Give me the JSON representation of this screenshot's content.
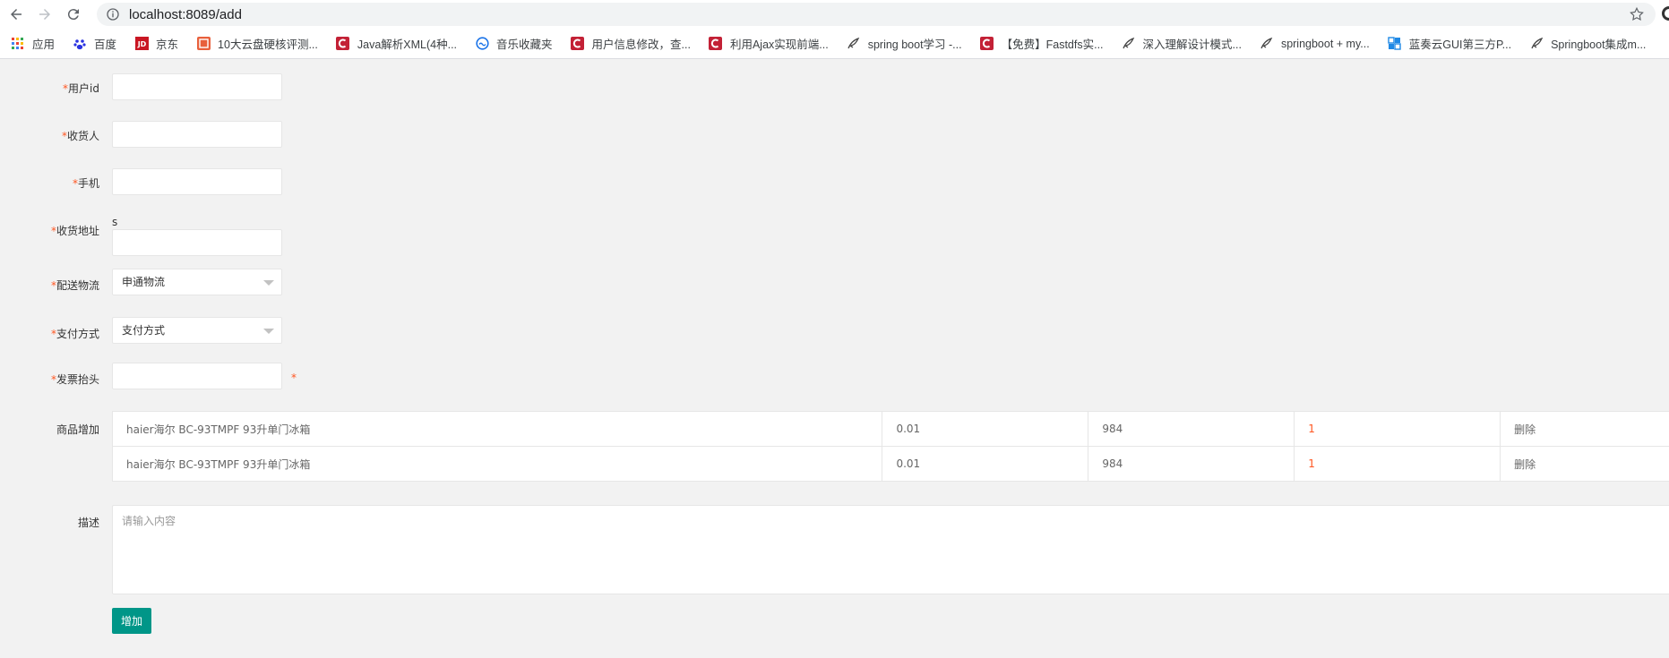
{
  "browser": {
    "url": "localhost:8089/add",
    "bookmarks": [
      {
        "label": "应用",
        "icon": "apps-grid-icon"
      },
      {
        "label": "百度",
        "icon": "baidu-paw-icon"
      },
      {
        "label": "京东",
        "icon": "jd-logo-icon"
      },
      {
        "label": "10大云盘硬核评测...",
        "icon": "jian-logo-icon"
      },
      {
        "label": "Java解析XML(4种...",
        "icon": "csdn-c-icon"
      },
      {
        "label": "音乐收藏夹",
        "icon": "music-circle-icon"
      },
      {
        "label": "用户信息修改，查...",
        "icon": "csdn-c-icon"
      },
      {
        "label": "利用Ajax实现前端...",
        "icon": "csdn-c-icon"
      },
      {
        "label": "spring boot学习 -...",
        "icon": "feather-icon"
      },
      {
        "label": "【免费】Fastdfs实...",
        "icon": "csdn-c-icon"
      },
      {
        "label": "深入理解设计模式...",
        "icon": "feather-icon"
      },
      {
        "label": "springboot + my...",
        "icon": "feather-icon"
      },
      {
        "label": "蓝奏云GUI第三方P...",
        "icon": "lanzou-icon"
      },
      {
        "label": "Springboot集成m...",
        "icon": "feather-icon"
      }
    ]
  },
  "form": {
    "required_mark": "*",
    "user_id": {
      "label": "用户id",
      "value": ""
    },
    "receiver": {
      "label": "收货人",
      "value": ""
    },
    "phone": {
      "label": "手机",
      "value": ""
    },
    "address": {
      "label": "收货地址",
      "value": "",
      "note": "s"
    },
    "logistics": {
      "label": "配送物流",
      "selected": "申通物流"
    },
    "payment": {
      "label": "支付方式",
      "selected": "支付方式"
    },
    "invoice": {
      "label": "发票抬头",
      "value": "",
      "trailing_mark": "*"
    },
    "goods": {
      "label": "商品增加",
      "rows": [
        {
          "name": "haier海尔 BC-93TMPF 93升单门冰箱",
          "price": "0.01",
          "stock": "984",
          "qty": "1",
          "action": "删除"
        },
        {
          "name": "haier海尔 BC-93TMPF 93升单门冰箱",
          "price": "0.01",
          "stock": "984",
          "qty": "1",
          "action": "删除"
        }
      ]
    },
    "description": {
      "label": "描述",
      "placeholder": "请输入内容"
    },
    "submit_label": "增加"
  },
  "colors": {
    "required": "#ff5722",
    "primary_button": "#009688",
    "page_background": "#f2f2f2"
  }
}
